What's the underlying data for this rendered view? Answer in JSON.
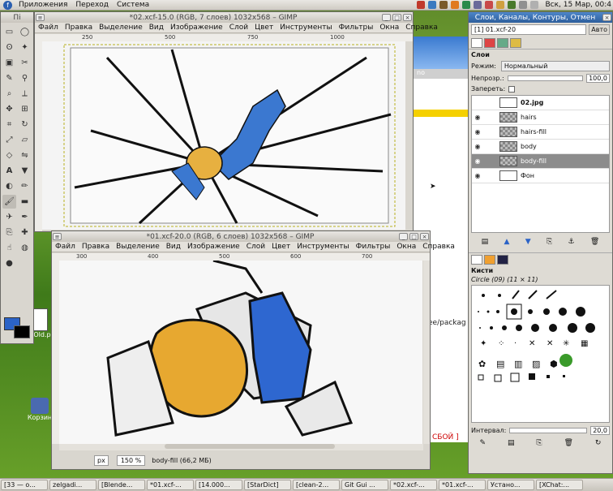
{
  "top_panel": {
    "menus": [
      "Приложения",
      "Переход",
      "Система"
    ],
    "clock": "Вск, 15 Мар, 00:4"
  },
  "toolbox": {
    "title": "Пі"
  },
  "window1": {
    "title": "*02.xcf-15.0 (RGB, 7 слоев) 1032x568 – GIMP",
    "menus": [
      "Файл",
      "Правка",
      "Выделение",
      "Вид",
      "Изображение",
      "Слой",
      "Цвет",
      "Инструменты",
      "Фильтры",
      "Окна",
      "Справка"
    ],
    "ruler_marks": [
      "250",
      "500",
      "750",
      "1000"
    ]
  },
  "window2": {
    "title": "*01.xcf-20.0 (RGB, 6 слоев) 1032x568 – GIMP",
    "menus": [
      "Файл",
      "Правка",
      "Выделение",
      "Вид",
      "Изображение",
      "Слой",
      "Цвет",
      "Инструменты",
      "Фильтры",
      "Окна",
      "Справка"
    ],
    "ruler_marks": [
      "300",
      "400",
      "500",
      "600",
      "700"
    ],
    "status": {
      "unit": "px",
      "zoom": "150 %",
      "layer_info": "body-fill (66,2 МБ)"
    }
  },
  "background_window": {
    "text_path": "ee/packag",
    "error_text": "СБОЙ ]",
    "header_text": "no"
  },
  "desktop_icons": [
    {
      "label": "AllOld.p"
    },
    {
      "label": "Корзин"
    }
  ],
  "dock": {
    "title": "Слои, Каналы, Контуры, Отмен",
    "image_select": "[1] 01.xcf-20",
    "auto_label": "Авто",
    "layers_title": "Слои",
    "mode_label": "Режим:",
    "mode_value": "Нормальный",
    "opacity_label": "Непрозр.:",
    "opacity_value": "100,0",
    "lock_label": "Запереть:",
    "layers": [
      {
        "name": "02.jpg",
        "bold": true,
        "visible": false
      },
      {
        "name": "hairs",
        "visible": true
      },
      {
        "name": "hairs-fill",
        "visible": true
      },
      {
        "name": "body",
        "visible": true
      },
      {
        "name": "body-fill",
        "visible": true,
        "selected": true
      },
      {
        "name": "Фон",
        "visible": true
      }
    ],
    "brushes_title": "Кисти",
    "brush_name": "Circle (09) (11 × 11)",
    "interval_label": "Интервал:",
    "interval_value": "20,0"
  },
  "taskbar": {
    "tasks": [
      "[33 — о...",
      "zelgadi...",
      "[Blende...",
      "*01.xcf-...",
      "[14.000...",
      "[StarDict]",
      "[clean-2...",
      "Git Gui ...",
      "*02.xcf-...",
      "*01.xcf-...",
      "Устано...",
      "[XChat:..."
    ]
  },
  "colors": {
    "fg": "#2b63c7",
    "bg": "#000000",
    "hair": "#e7a830",
    "shirt": "#2e67d0"
  }
}
